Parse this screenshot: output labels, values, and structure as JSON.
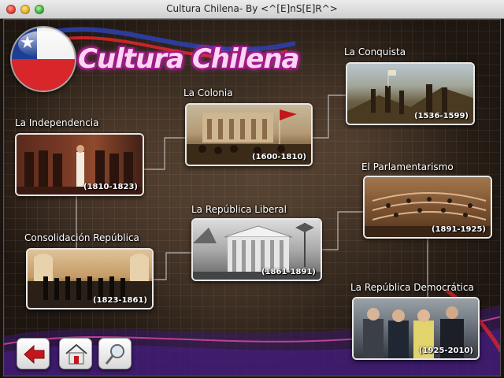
{
  "window": {
    "title": "Cultura Chilena- By <^[E]nS[E]R^>"
  },
  "header": {
    "title": "Cultura Chilena",
    "logo_icon": "chile-flag-ball-icon"
  },
  "eras": [
    {
      "id": "la-conquista",
      "label": "La Conquista",
      "years": "(1536-1599)"
    },
    {
      "id": "la-colonia",
      "label": "La Colonia",
      "years": "(1600-1810)"
    },
    {
      "id": "la-independencia",
      "label": "La Independencia",
      "years": "(1810-1823)"
    },
    {
      "id": "la-republica-liberal",
      "label": "La República Liberal",
      "years": "(1861-1891)"
    },
    {
      "id": "el-parlamentarismo",
      "label": "El Parlamentarismo",
      "years": "(1891-1925)"
    },
    {
      "id": "consolidacion-republica",
      "label": "Consolidación República",
      "years": "(1823-1861)"
    },
    {
      "id": "la-republica-democratica",
      "label": "La República Democrática",
      "years": "(1925-2010)"
    }
  ],
  "nav": {
    "back_icon": "back-arrow-icon",
    "home_icon": "home-icon",
    "search_icon": "magnifier-icon"
  },
  "colors": {
    "title_fill": "#ffd6f2",
    "title_outline": "#a01a8a",
    "back_arrow": "#c4161c"
  }
}
